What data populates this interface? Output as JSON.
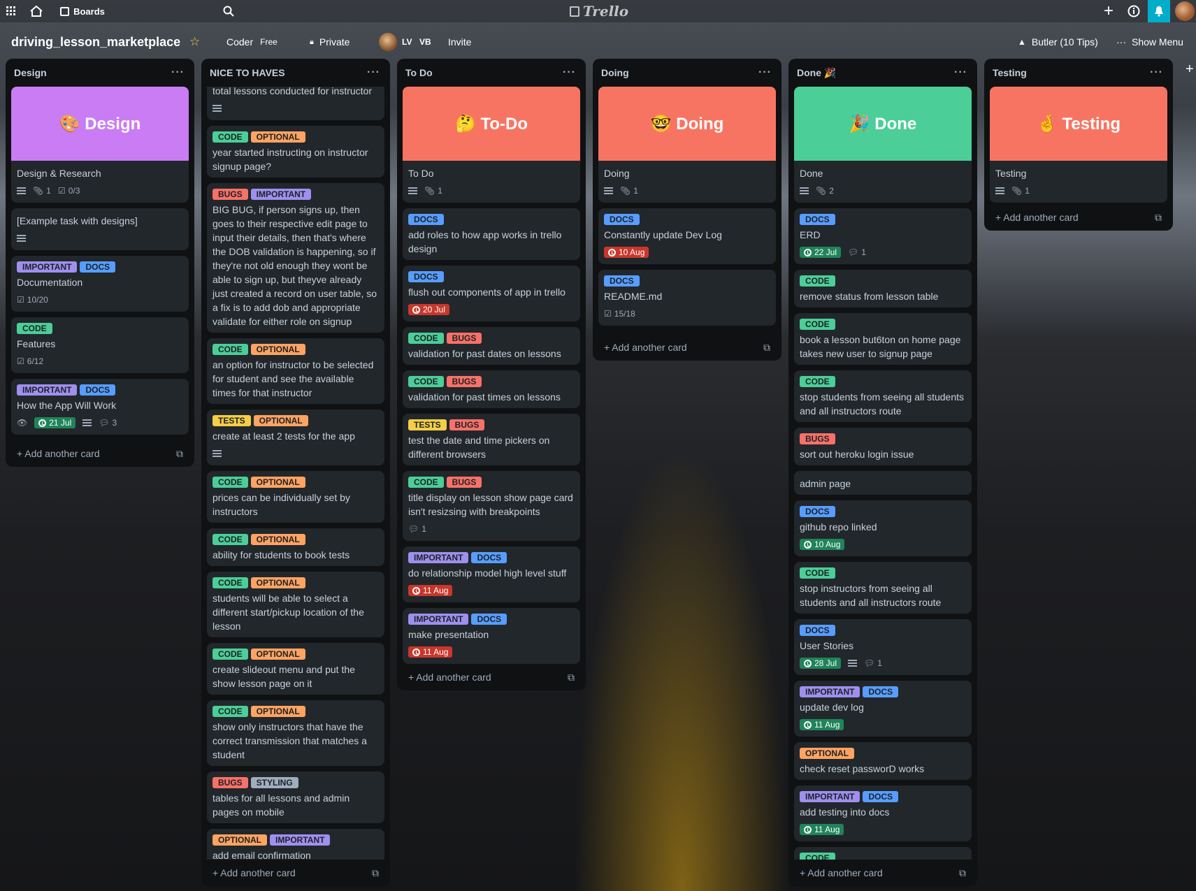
{
  "colors": {
    "list_bg": "#0f1113",
    "card_bg": "#22272b",
    "label_code": "#4bce97",
    "label_optional": "#fea362",
    "label_bugs": "#f87168",
    "label_important": "#9f8fef",
    "label_docs": "#579dff",
    "label_tests": "#f5cd47",
    "label_styling": "#9fadbc",
    "cover_purple": "#c97cf4",
    "cover_red": "#f87462",
    "cover_green": "#4bce97",
    "due_overdue": "#c9372c",
    "due_done": "#1f845a"
  },
  "topbar": {
    "apps_icon": "grid-icon",
    "home_icon": "home-icon",
    "boards_label": "Boards",
    "search_icon": "search-icon",
    "logo_text": "Trello",
    "add_icon": "plus-icon",
    "info_icon": "info-icon",
    "notification_icon": "bell-icon",
    "avatar_icon": "avatar-icon"
  },
  "board": {
    "title": "driving_lesson_marketplace",
    "star_icon": "star-icon",
    "team": "Coder",
    "plan": "Free",
    "visibility": "Private",
    "member_1": "LV",
    "member_2": "VB",
    "invite": "Invite",
    "butler": "Butler (10 Tips)",
    "show_menu": "Show Menu"
  },
  "lists": [
    {
      "name": "Design",
      "add_card": "Add another card",
      "cards": [
        {
          "cover": "🎨 Design",
          "cover_color": "#c97cf4",
          "title": "Design & Research",
          "labels": [],
          "desc": true,
          "attachments": "1",
          "checklist": "0/3"
        },
        {
          "title": "[Example task with designs]",
          "labels": [],
          "desc": true
        },
        {
          "title": "Documentation",
          "labels": [
            [
              "IMPORTANT",
              "#9f8fef"
            ],
            [
              "DOCS",
              "#579dff"
            ]
          ],
          "checklist": "10/20"
        },
        {
          "title": "Features",
          "labels": [
            [
              "CODE",
              "#4bce97"
            ]
          ],
          "checklist": "6/12"
        },
        {
          "title": "How the App Will Work",
          "labels": [
            [
              "IMPORTANT",
              "#9f8fef"
            ],
            [
              "DOCS",
              "#579dff"
            ]
          ],
          "watch": true,
          "due": "21 Jul",
          "due_state": "done",
          "desc": true,
          "comments": "3"
        }
      ]
    },
    {
      "name": "NICE TO HAVES",
      "add_card": "Add another card",
      "cards": [
        {
          "title": "total lessons conducted for instructor",
          "labels": [],
          "desc": true,
          "clipped_top": true
        },
        {
          "title": "year started instructing on instructor signup page?",
          "labels": [
            [
              "CODE",
              "#4bce97"
            ],
            [
              "OPTIONAL",
              "#fea362"
            ]
          ]
        },
        {
          "title": "BIG BUG, if person signs up, then goes to their respective edit page to input their details, then that's where the DOB validation is happening, so if they're not old enough they wont be able to sign up, but theyve already just created a record on user table, so a fix is to add dob and appropriate validate for either role on signup",
          "labels": [
            [
              "BUGS",
              "#f87168"
            ],
            [
              "IMPORTANT",
              "#9f8fef"
            ]
          ]
        },
        {
          "title": "an option for instructor to be selected for student and see the available times for that instructor",
          "labels": [
            [
              "CODE",
              "#4bce97"
            ],
            [
              "OPTIONAL",
              "#fea362"
            ]
          ]
        },
        {
          "title": "create at least 2 tests for the app",
          "labels": [
            [
              "TESTS",
              "#f5cd47"
            ],
            [
              "OPTIONAL",
              "#fea362"
            ]
          ],
          "desc": true
        },
        {
          "title": "prices can be individually set by instructors",
          "labels": [
            [
              "CODE",
              "#4bce97"
            ],
            [
              "OPTIONAL",
              "#fea362"
            ]
          ]
        },
        {
          "title": "ability for students to book tests",
          "labels": [
            [
              "CODE",
              "#4bce97"
            ],
            [
              "OPTIONAL",
              "#fea362"
            ]
          ]
        },
        {
          "title": "students will be able to select a different start/pickup location of the lesson",
          "labels": [
            [
              "CODE",
              "#4bce97"
            ],
            [
              "OPTIONAL",
              "#fea362"
            ]
          ]
        },
        {
          "title": "create slideout menu and put the show lesson page on it",
          "labels": [
            [
              "CODE",
              "#4bce97"
            ],
            [
              "OPTIONAL",
              "#fea362"
            ]
          ]
        },
        {
          "title": "show only instructors that have the correct transmission that matches a student",
          "labels": [
            [
              "CODE",
              "#4bce97"
            ],
            [
              "OPTIONAL",
              "#fea362"
            ]
          ]
        },
        {
          "title": "tables for all lessons and admin pages on mobile",
          "labels": [
            [
              "BUGS",
              "#f87168"
            ],
            [
              "STYLING",
              "#9fadbc"
            ]
          ]
        },
        {
          "title": "add email confirmation",
          "labels": [
            [
              "OPTIONAL",
              "#fea362"
            ],
            [
              "IMPORTANT",
              "#9f8fef"
            ]
          ]
        }
      ]
    },
    {
      "name": "To Do",
      "add_card": "Add another card",
      "cards": [
        {
          "cover": "🤔 To-Do",
          "cover_color": "#f87462",
          "title": "To Do",
          "labels": [],
          "desc": true,
          "attachments": "1"
        },
        {
          "title": "add roles to how app works in trello design",
          "labels": [
            [
              "DOCS",
              "#579dff"
            ]
          ]
        },
        {
          "title": "flush out components of app in trello",
          "labels": [
            [
              "DOCS",
              "#579dff"
            ]
          ],
          "due": "20 Jul",
          "due_state": "overdue"
        },
        {
          "title": "validation for past dates on lessons",
          "labels": [
            [
              "CODE",
              "#4bce97"
            ],
            [
              "BUGS",
              "#f87168"
            ]
          ]
        },
        {
          "title": "validation for past times on lessons",
          "labels": [
            [
              "CODE",
              "#4bce97"
            ],
            [
              "BUGS",
              "#f87168"
            ]
          ]
        },
        {
          "title": "test the date and time pickers on different browsers",
          "labels": [
            [
              "TESTS",
              "#f5cd47"
            ],
            [
              "BUGS",
              "#f87168"
            ]
          ]
        },
        {
          "title": "title display on lesson show page card isn't resizsing with breakpoints",
          "labels": [
            [
              "CODE",
              "#4bce97"
            ],
            [
              "BUGS",
              "#f87168"
            ]
          ],
          "comments": "1"
        },
        {
          "title": "do relationship model high level stuff",
          "labels": [
            [
              "IMPORTANT",
              "#9f8fef"
            ],
            [
              "DOCS",
              "#579dff"
            ]
          ],
          "due": "11 Aug",
          "due_state": "overdue"
        },
        {
          "title": "make presentation",
          "labels": [
            [
              "IMPORTANT",
              "#9f8fef"
            ],
            [
              "DOCS",
              "#579dff"
            ]
          ],
          "due": "11 Aug",
          "due_state": "overdue"
        }
      ]
    },
    {
      "name": "Doing",
      "add_card": "Add another card",
      "cards": [
        {
          "cover": "🤓 Doing",
          "cover_color": "#f87462",
          "title": "Doing",
          "labels": [],
          "desc": true,
          "attachments": "1"
        },
        {
          "title": "Constantly update Dev Log",
          "labels": [
            [
              "DOCS",
              "#579dff"
            ]
          ],
          "due": "10 Aug",
          "due_state": "overdue"
        },
        {
          "title": "README.md",
          "labels": [
            [
              "DOCS",
              "#579dff"
            ]
          ],
          "checklist": "15/18"
        }
      ]
    },
    {
      "name": "Done 🎉",
      "add_card": "Add another card",
      "cards": [
        {
          "cover": "🎉 Done",
          "cover_color": "#4bce97",
          "title": "Done",
          "labels": [],
          "desc": true,
          "attachments": "2"
        },
        {
          "title": "ERD",
          "labels": [
            [
              "DOCS",
              "#579dff"
            ]
          ],
          "due": "22 Jul",
          "due_state": "done",
          "comments": "1"
        },
        {
          "title": "remove status from lesson table",
          "labels": [
            [
              "CODE",
              "#4bce97"
            ]
          ]
        },
        {
          "title": "book a lesson but6ton on home page takes new user to signup page",
          "labels": [
            [
              "CODE",
              "#4bce97"
            ]
          ]
        },
        {
          "title": "stop students from seeing all students and all instructors route",
          "labels": [
            [
              "CODE",
              "#4bce97"
            ]
          ]
        },
        {
          "title": "sort out heroku login issue",
          "labels": [
            [
              "BUGS",
              "#f87168"
            ]
          ]
        },
        {
          "title": "admin page",
          "labels": []
        },
        {
          "title": "github repo linked",
          "labels": [
            [
              "DOCS",
              "#579dff"
            ]
          ],
          "due": "10 Aug",
          "due_state": "done"
        },
        {
          "title": "stop instructors from seeing all students and all instructors route",
          "labels": [
            [
              "CODE",
              "#4bce97"
            ]
          ]
        },
        {
          "title": "User Stories",
          "labels": [
            [
              "DOCS",
              "#579dff"
            ]
          ],
          "due": "28 Jul",
          "due_state": "done",
          "desc": true,
          "comments": "1"
        },
        {
          "title": "update dev log",
          "labels": [
            [
              "IMPORTANT",
              "#9f8fef"
            ],
            [
              "DOCS",
              "#579dff"
            ]
          ],
          "due": "11 Aug",
          "due_state": "done"
        },
        {
          "title": "check reset passworD works",
          "labels": [
            [
              "OPTIONAL",
              "#fea362"
            ]
          ]
        },
        {
          "title": "add testing into docs",
          "labels": [
            [
              "IMPORTANT",
              "#9f8fef"
            ],
            [
              "DOCS",
              "#579dff"
            ]
          ],
          "due": "11 Aug",
          "due_state": "done"
        },
        {
          "title": "",
          "labels": [
            [
              "CODE",
              "#4bce97"
            ]
          ]
        }
      ]
    },
    {
      "name": "Testing",
      "add_card": "Add another card",
      "cards": [
        {
          "cover": "🤞 Testing",
          "cover_color": "#f87462",
          "title": "Testing",
          "labels": [],
          "desc": true,
          "attachments": "1"
        }
      ]
    }
  ]
}
